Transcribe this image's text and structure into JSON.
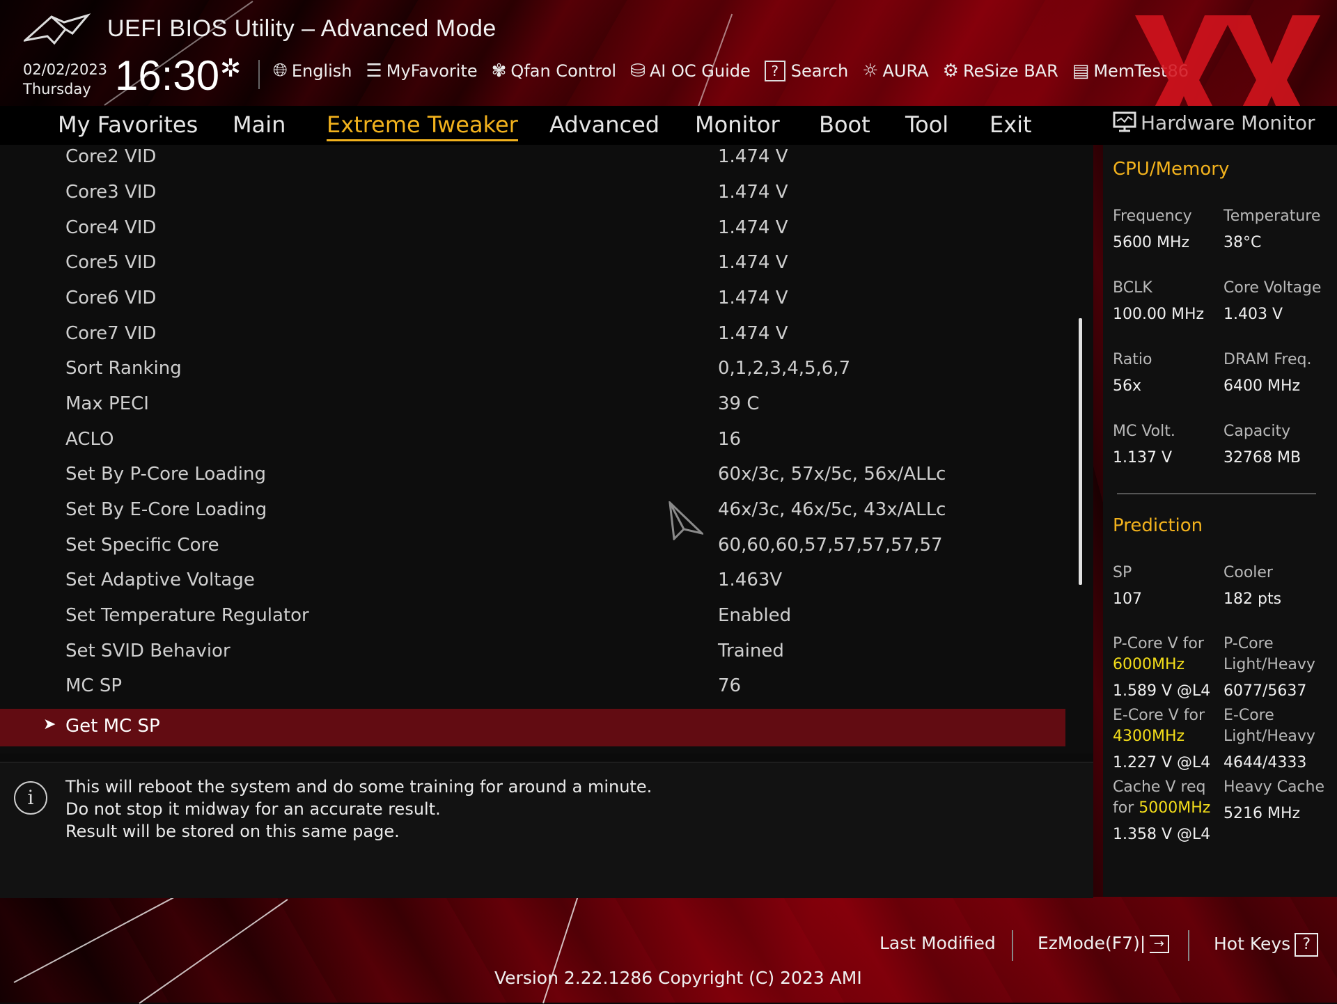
{
  "header": {
    "title": "UEFI BIOS Utility – Advanced Mode",
    "date": "02/02/2023",
    "weekday": "Thursday",
    "time": "16:30",
    "tools": [
      {
        "label": "English",
        "icon": "globe-icon"
      },
      {
        "label": "MyFavorite",
        "icon": "favorite-list-icon"
      },
      {
        "label": "Qfan Control",
        "icon": "fan-icon"
      },
      {
        "label": "AI OC Guide",
        "icon": "ai-oc-guide-icon"
      },
      {
        "label": "Search",
        "icon": "search-icon"
      },
      {
        "label": "AURA",
        "icon": "aura-icon"
      },
      {
        "label": "ReSize BAR",
        "icon": "resize-bar-icon"
      },
      {
        "label": "MemTest86",
        "icon": "memtest-icon"
      }
    ]
  },
  "menu": {
    "items": [
      "My Favorites",
      "Main",
      "Extreme Tweaker",
      "Advanced",
      "Monitor",
      "Boot",
      "Tool",
      "Exit"
    ],
    "active": "Extreme Tweaker"
  },
  "settings": [
    {
      "label": "Core2 VID",
      "value": "1.474 V"
    },
    {
      "label": "Core3 VID",
      "value": "1.474 V"
    },
    {
      "label": "Core4 VID",
      "value": "1.474 V"
    },
    {
      "label": "Core5 VID",
      "value": "1.474 V"
    },
    {
      "label": "Core6 VID",
      "value": "1.474 V"
    },
    {
      "label": "Core7 VID",
      "value": "1.474 V"
    },
    {
      "label": "Sort Ranking",
      "value": "0,1,2,3,4,5,6,7"
    },
    {
      "label": "Max PECI",
      "value": "39 C"
    },
    {
      "label": "ACLO",
      "value": "16"
    },
    {
      "label": "Set By P-Core Loading",
      "value": "60x/3c, 57x/5c, 56x/ALLc"
    },
    {
      "label": "Set By E-Core Loading",
      "value": "46x/3c, 46x/5c, 43x/ALLc"
    },
    {
      "label": "Set Specific Core",
      "value": "60,60,60,57,57,57,57,57"
    },
    {
      "label": "Set Adaptive Voltage",
      "value": "1.463V"
    },
    {
      "label": "Set Temperature Regulator",
      "value": "Enabled"
    },
    {
      "label": "Set SVID Behavior",
      "value": "Trained"
    },
    {
      "label": "MC SP",
      "value": "76"
    }
  ],
  "selected_item": {
    "label": "Get MC SP"
  },
  "help": {
    "lines": [
      "This will reboot the system and do some training for around a minute.",
      "Do not stop it midway for an accurate result.",
      "Result will be stored on this same page."
    ]
  },
  "hw_monitor": {
    "title": "Hardware Monitor",
    "cpu_memory": {
      "heading": "CPU/Memory",
      "items": [
        {
          "key": "Frequency",
          "value": "5600 MHz"
        },
        {
          "key": "Temperature",
          "value": "38°C"
        },
        {
          "key": "BCLK",
          "value": "100.00 MHz"
        },
        {
          "key": "Core Voltage",
          "value": "1.403 V"
        },
        {
          "key": "Ratio",
          "value": "56x"
        },
        {
          "key": "DRAM Freq.",
          "value": "6400 MHz"
        },
        {
          "key": "MC Volt.",
          "value": "1.137 V"
        },
        {
          "key": "Capacity",
          "value": "32768 MB"
        }
      ]
    },
    "prediction": {
      "heading": "Prediction",
      "sp_key": "SP",
      "sp_value": "107",
      "cooler_key": "Cooler",
      "cooler_value": "182 pts",
      "pcore_key_1": "P-Core V for",
      "pcore_freq": "6000MHz",
      "pcore_value": "1.589 V @L4",
      "pcore_lh_key_1": "P-Core",
      "pcore_lh_key_2": "Light/Heavy",
      "pcore_lh_value": "6077/5637",
      "ecore_key_1": "E-Core V for",
      "ecore_freq": "4300MHz",
      "ecore_value": "1.227 V @L4",
      "ecore_lh_key_1": "E-Core",
      "ecore_lh_key_2": "Light/Heavy",
      "ecore_lh_value": "4644/4333",
      "cache_key_1": "Cache V req",
      "cache_key_2_prefix": "for",
      "cache_freq": "5000MHz",
      "cache_value": "1.358 V @L4",
      "heavy_cache_key": "Heavy Cache",
      "heavy_cache_value": "5216 MHz"
    }
  },
  "footer": {
    "last_modified": "Last Modified",
    "ezmode": "EzMode(F7)|",
    "hot_keys": "Hot Keys",
    "version": "Version 2.22.1286 Copyright (C) 2023 AMI"
  },
  "colors": {
    "accent": "#f2b21d",
    "selection": "#620c12",
    "highlight": "#f4de1a",
    "background": "#0d0d0d"
  }
}
